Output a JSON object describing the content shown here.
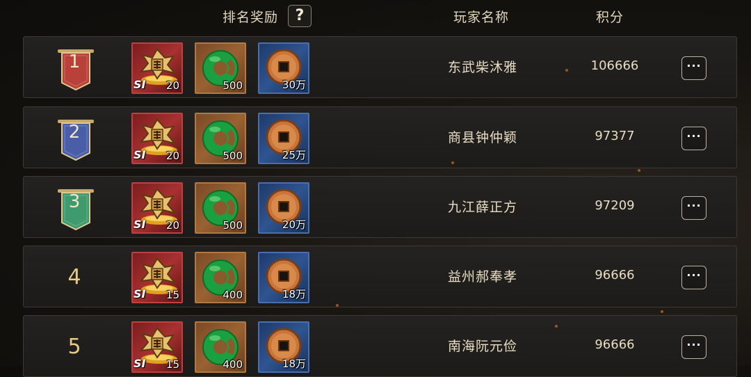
{
  "header": {
    "reward_label": "排名奖励",
    "help_label": "?",
    "player_label": "玩家名称",
    "score_label": "积分"
  },
  "rows": [
    {
      "rank": "1",
      "banner_color": "#b8413a",
      "rewards": {
        "soul_tier": "SI",
        "soul_qty": "20",
        "jade_qty": "500",
        "coin_qty": "30万"
      },
      "player": "东武柴沐雅",
      "score": "106666",
      "more": "···"
    },
    {
      "rank": "2",
      "banner_color": "#4a5ea8",
      "rewards": {
        "soul_tier": "SI",
        "soul_qty": "20",
        "jade_qty": "500",
        "coin_qty": "25万"
      },
      "player": "商县钟仲颖",
      "score": "97377",
      "more": "···"
    },
    {
      "rank": "3",
      "banner_color": "#3f9a6e",
      "rewards": {
        "soul_tier": "SI",
        "soul_qty": "20",
        "jade_qty": "500",
        "coin_qty": "20万"
      },
      "player": "九江薛正方",
      "score": "97209",
      "more": "···"
    },
    {
      "rank": "4",
      "banner_color": "",
      "rewards": {
        "soul_tier": "SI",
        "soul_qty": "15",
        "jade_qty": "400",
        "coin_qty": "18万"
      },
      "player": "益州郝奉孝",
      "score": "96666",
      "more": "···"
    },
    {
      "rank": "5",
      "banner_color": "",
      "rewards": {
        "soul_tier": "SI",
        "soul_qty": "15",
        "jade_qty": "400",
        "coin_qty": "18万"
      },
      "player": "南海阮元俭",
      "score": "96666",
      "more": "···"
    }
  ],
  "icons": {
    "soul": "soul-token-icon",
    "jade": "jade-ring-icon",
    "coin": "copper-coin-icon",
    "more": "more-options-icon",
    "help": "help-icon"
  }
}
